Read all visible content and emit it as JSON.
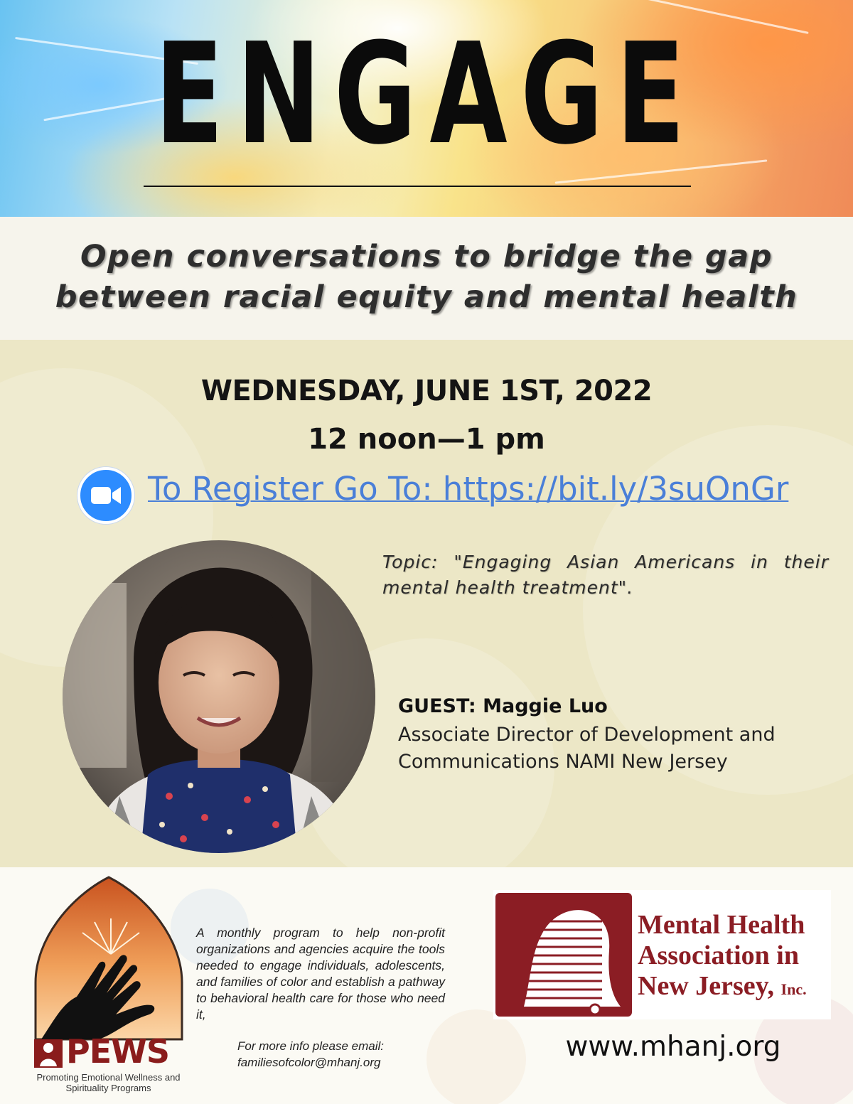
{
  "header": {
    "title": "ENGAGE"
  },
  "subtitle": {
    "line1": "Open conversations to bridge the gap",
    "line2": "between racial equity and mental health"
  },
  "event": {
    "date": "WEDNESDAY, JUNE 1ST, 2022",
    "time": "12 noon—1 pm",
    "register_text": "To Register Go To: https://bit.ly/3suOnGr",
    "register_icon": "zoom-video-icon",
    "icon_color": "#2d8cff",
    "link_color": "#4a7fd8"
  },
  "topic": {
    "text": "Topic: \"Engaging Asian Americans in their mental health treatment\"."
  },
  "guest": {
    "label": "GUEST: Maggie Luo",
    "title": "Associate Director of Development and Communications NAMI New Jersey"
  },
  "footer": {
    "pews": {
      "word": "PEWS",
      "tagline": "Promoting Emotional Wellness and Spirituality Programs",
      "color": "#8a1c1c"
    },
    "program_description": "A monthly program to help non-profit organizations and agencies acquire the tools needed to engage individuals, adolescents, and families of color and establish a pathway to behavioral health care for those who need it,",
    "contact_line1": "For more info please email:",
    "contact_line2": "familiesofcolor@mhanj.org",
    "mha": {
      "name_line1": "Mental Health",
      "name_line2": "Association in",
      "name_line3": "New Jersey,",
      "name_suffix": "Inc.",
      "url": "www.mhanj.org",
      "color": "#8b1d24"
    }
  }
}
